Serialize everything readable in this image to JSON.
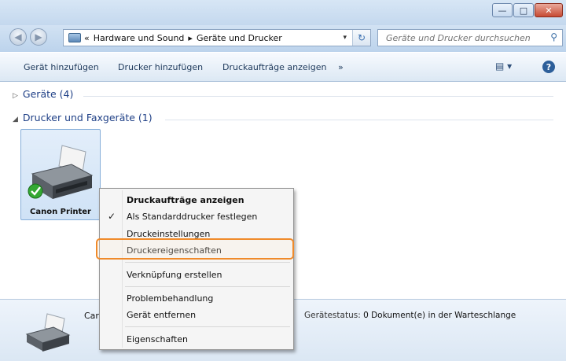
{
  "window": {
    "minimize_glyph": "—",
    "maximize_glyph": "□",
    "close_glyph": "✕"
  },
  "nav": {
    "back_glyph": "◀",
    "forward_glyph": "▶",
    "address_prefix": "«",
    "breadcrumb_1": "Hardware und Sound",
    "breadcrumb_sep": "▸",
    "breadcrumb_2": "Geräte und Drucker",
    "dropdown_glyph": "▾",
    "refresh_glyph": "↻",
    "search_placeholder": "Geräte und Drucker durchsuchen",
    "search_glyph": "⚲"
  },
  "toolbar": {
    "add_device": "Gerät hinzufügen",
    "add_printer": "Drucker hinzufügen",
    "show_jobs": "Druckaufträge anzeigen",
    "more": "»",
    "view_glyph": "▤ ▾",
    "help_glyph": "?"
  },
  "groups": {
    "devices": "Geräte (4)",
    "devices_tri": "▷",
    "printers": "Drucker und Faxgeräte (1)",
    "printers_tri": "◢"
  },
  "printer": {
    "label": "Canon Printer",
    "default_check": "✓"
  },
  "details": {
    "name_partial": "Car",
    "status_label": "Gerätestatus:",
    "status_value": "0 Dokument(e) in der Warteschlange"
  },
  "context_menu": {
    "item_1": "Druckaufträge anzeigen",
    "item_2": "Als Standarddrucker festlegen",
    "item_2_check": "✓",
    "item_3": "Druckeinstellungen",
    "item_4": "Druckereigenschaften",
    "item_5": "Verknüpfung erstellen",
    "item_6": "Problembehandlung",
    "item_7": "Gerät entfernen",
    "item_8": "Eigenschaften"
  },
  "colors": {
    "highlight_outline": "#f08a2a",
    "accent_link": "#1e3f86",
    "selection_tile": "#cfe2f6"
  }
}
